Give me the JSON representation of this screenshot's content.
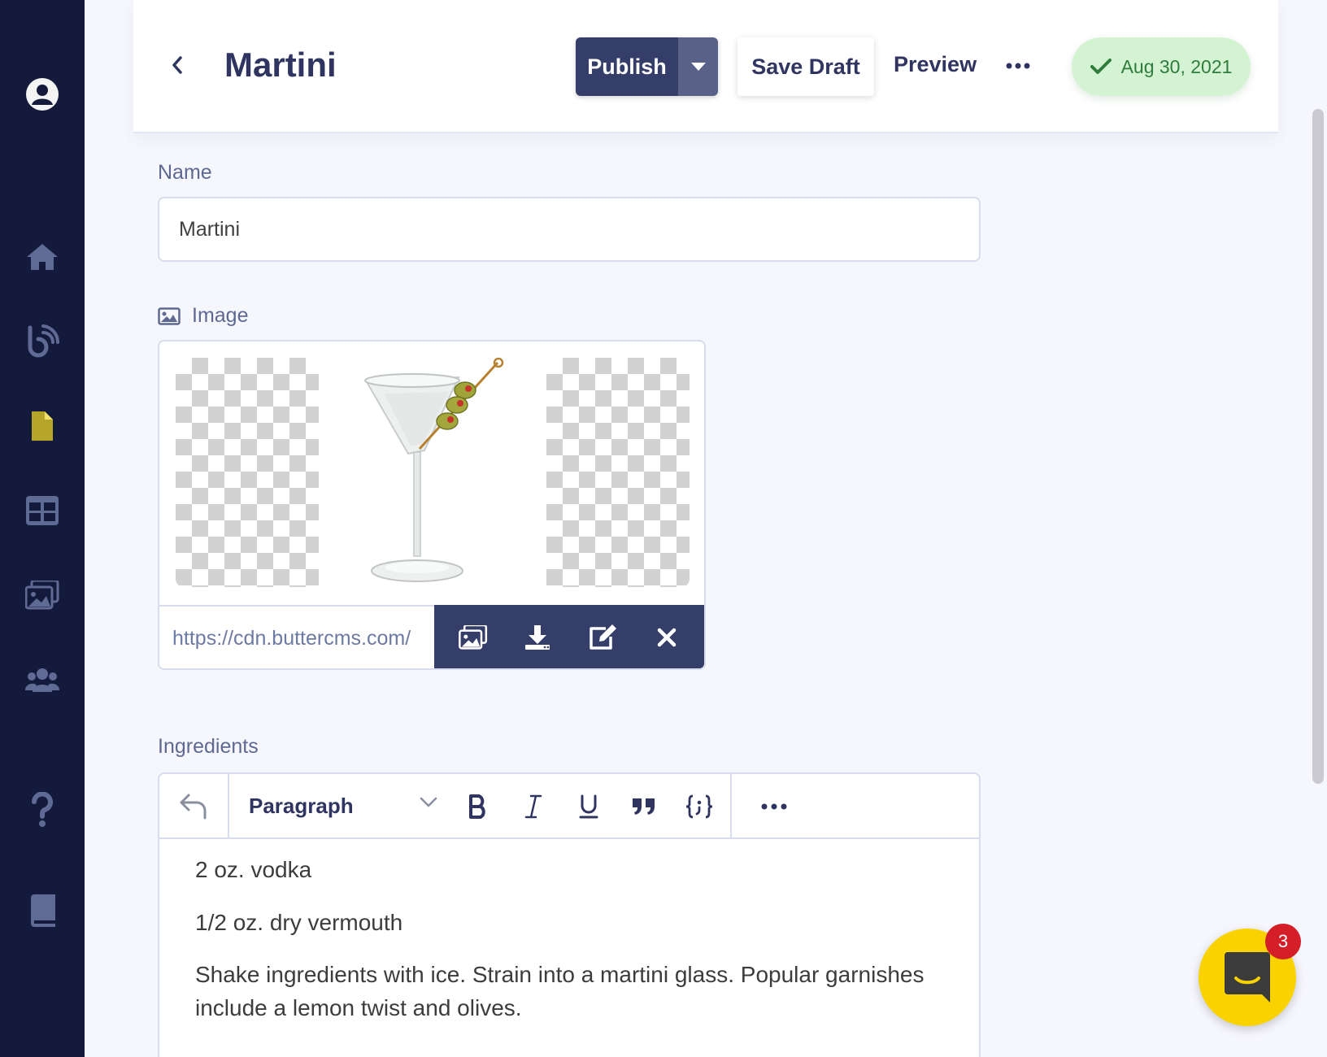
{
  "sidebar": {
    "items": [
      {
        "icon": "avatar-icon"
      },
      {
        "icon": "home-icon"
      },
      {
        "icon": "blog-icon"
      },
      {
        "icon": "page-icon",
        "active": true,
        "color": "#b7a52a"
      },
      {
        "icon": "grid-icon"
      },
      {
        "icon": "media-icon"
      },
      {
        "icon": "users-icon"
      },
      {
        "icon": "help-icon"
      },
      {
        "icon": "book-icon"
      }
    ]
  },
  "header": {
    "title": "Martini",
    "publish_label": "Publish",
    "save_draft_label": "Save Draft",
    "preview_label": "Preview",
    "status_date": "Aug 30, 2021"
  },
  "fields": {
    "name": {
      "label": "Name",
      "value": "Martini"
    },
    "image": {
      "label": "Image",
      "url": "https://cdn.buttercms.com/"
    },
    "ingredients": {
      "label": "Ingredients",
      "format": "Paragraph",
      "paragraphs": [
        "2 oz. vodka",
        "1/2 oz. dry vermouth",
        "Shake ingredients with ice. Strain into a martini glass. Popular garnishes include a lemon twist and olives."
      ]
    }
  },
  "chat": {
    "badge_count": "3"
  },
  "colors": {
    "sidebar_bg": "#141a3c",
    "primary": "#353d69",
    "status_green_bg": "#d4f3d3",
    "status_green_text": "#2f7d3d",
    "chat_yellow": "#fad200",
    "badge_red": "#d41f28"
  }
}
